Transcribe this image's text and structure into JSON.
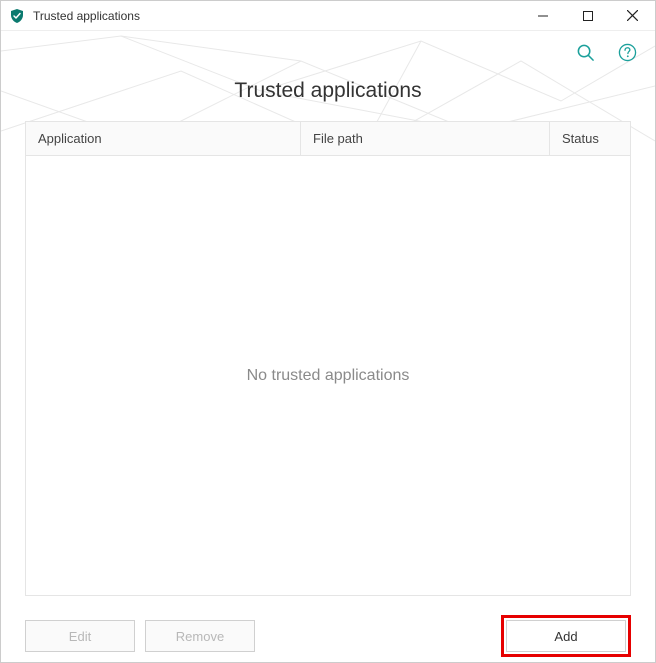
{
  "window": {
    "title": "Trusted applications"
  },
  "page": {
    "title": "Trusted applications"
  },
  "columns": {
    "application": "Application",
    "file_path": "File path",
    "status": "Status"
  },
  "empty": {
    "message": "No trusted applications"
  },
  "buttons": {
    "edit": "Edit",
    "remove": "Remove",
    "add": "Add"
  }
}
